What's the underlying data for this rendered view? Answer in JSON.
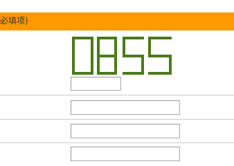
{
  "header": {
    "text": "必填项)"
  },
  "captcha": {
    "code": "0855",
    "color": "#4a7a1c"
  },
  "form": {
    "captcha_input_value": "",
    "field_1_value": "",
    "field_2_value": "",
    "field_3_value": ""
  },
  "colors": {
    "header_bg": "#ff9900",
    "divider": "#cccccc"
  }
}
